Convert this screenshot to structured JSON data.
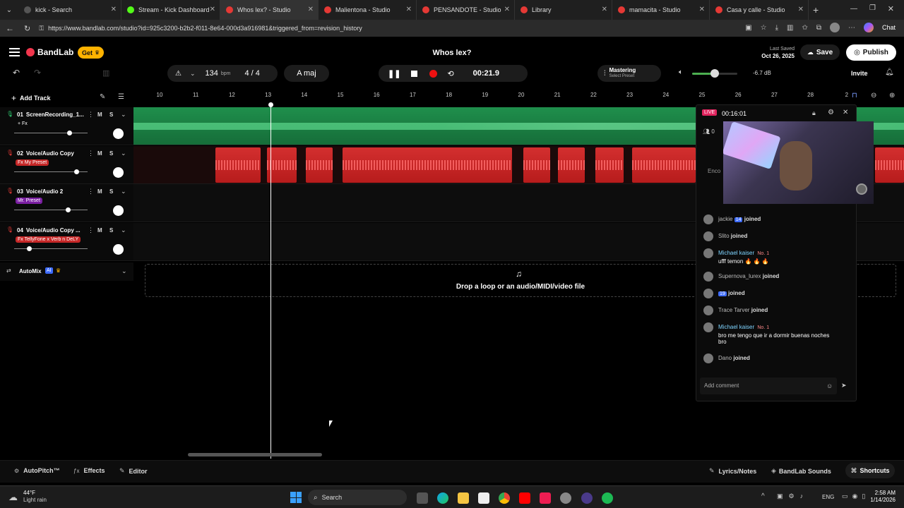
{
  "browser": {
    "tabs": [
      {
        "label": "kick - Search",
        "color": "#555",
        "active": false
      },
      {
        "label": "Stream - Kick Dashboard",
        "color": "#53fc18",
        "active": false
      },
      {
        "label": "Whos lex? - Studio",
        "color": "#e53935",
        "active": true
      },
      {
        "label": "Malientona - Studio",
        "color": "#e53935",
        "active": false
      },
      {
        "label": "PENSANDOTE - Studio",
        "color": "#e53935",
        "active": false
      },
      {
        "label": "Library",
        "color": "#e53935",
        "active": false
      },
      {
        "label": "mamacita - Studio",
        "color": "#e53935",
        "active": false
      },
      {
        "label": "Casa y calle - Studio",
        "color": "#e53935",
        "active": false
      }
    ],
    "url": "https://www.bandlab.com/studio?id=925c3200-b2b2-f011-8e64-000d3a916981&triggered_from=revision_history",
    "copilot_label": "Chat"
  },
  "header": {
    "brand": "BandLab",
    "get_label": "Get",
    "project_title": "Whos lex?",
    "last_saved_label": "Last Saved",
    "last_saved_date": "Oct 26, 2025",
    "save_label": "Save",
    "publish_label": "Publish"
  },
  "transport": {
    "tempo": "134",
    "tempo_unit": "bpm",
    "time_signature": "4 / 4",
    "key": "A maj",
    "time": "00:21.9",
    "mastering_label": "Mastering",
    "mastering_sub": "Select Preset",
    "volume_db": "-6.7 dB",
    "volume_level": 0.5,
    "invite_label": "Invite"
  },
  "tracks_header": {
    "add_track": "Add Track"
  },
  "ruler": [
    "10",
    "11",
    "12",
    "13",
    "14",
    "15",
    "16",
    "17",
    "18",
    "19",
    "20",
    "21",
    "22",
    "23",
    "24",
    "25",
    "26",
    "27",
    "28",
    "2"
  ],
  "tracks": [
    {
      "num": "01",
      "name": "ScreenRecording_1...",
      "fx": "+ Fx",
      "fx_color": "transparent",
      "color": "#2ecc71",
      "volume": 0.75
    },
    {
      "num": "02",
      "name": "Voice/Audio Copy",
      "fx": "Fx My Preset",
      "fx_color": "#c62828",
      "color": "#e53935",
      "volume": 0.85
    },
    {
      "num": "03",
      "name": "Voice/Audio 2",
      "fx": "Mr. Preset",
      "fx_color": "#7b1fa2",
      "color": "#e53935",
      "volume": 0.73
    },
    {
      "num": "04",
      "name": "Voice/Audio Copy ...",
      "fx": "Fx TellyFone x Verb n DeLY",
      "fx_color": "#c62828",
      "color": "#e53935",
      "volume": 0.2
    }
  ],
  "automix": {
    "label": "AutoMix",
    "badge": "AI"
  },
  "drop_zone": {
    "label": "Drop a loop or an audio/MIDI/video file"
  },
  "live": {
    "badge": "LIVE",
    "duration": "00:16:01",
    "viewers": "0",
    "overlay_text": "Enco",
    "comment_placeholder": "Add comment",
    "messages": [
      {
        "user": "jackie",
        "badge": "14",
        "text": "joined"
      },
      {
        "user": "Slito",
        "text": "joined"
      },
      {
        "user": "Michael kaiser",
        "badge": "No. 1",
        "text": "ufff temon 🔥 🔥 🔥"
      },
      {
        "user": "Supernova_lurex",
        "text": "joined"
      },
      {
        "user": "",
        "badge": "19",
        "text": "joined"
      },
      {
        "user": "Trace Tarver",
        "text": "joined"
      },
      {
        "user": "Michael kaiser",
        "badge": "No. 1",
        "text": "bro me tengo que ir a dormir buenas noches bro"
      },
      {
        "user": "Dano",
        "text": "joined"
      }
    ]
  },
  "bottom_bar": {
    "autopitch": "AutoPitch™",
    "effects": "Effects",
    "editor": "Editor",
    "lyrics": "Lyrics/Notes",
    "sounds": "BandLab Sounds",
    "shortcuts": "Shortcuts"
  },
  "taskbar": {
    "temp": "44°F",
    "weather": "Light rain",
    "search": "Search",
    "lang": "ENG",
    "time": "2:58 AM",
    "date": "1/14/2026"
  }
}
